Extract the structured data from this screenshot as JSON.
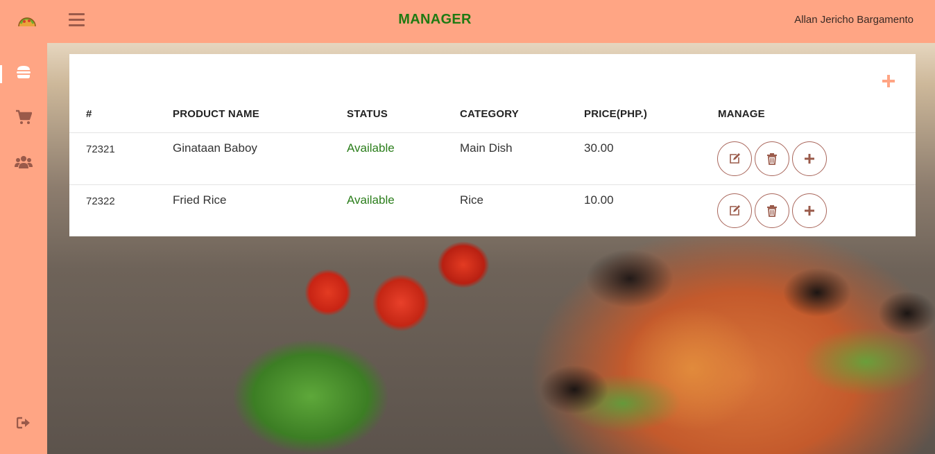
{
  "header": {
    "title": "MANAGER",
    "user_name": "Allan Jericho Bargamento"
  },
  "sidebar": {
    "items": [
      {
        "icon": "burger-icon",
        "active": true
      },
      {
        "icon": "cart-icon",
        "active": false
      },
      {
        "icon": "users-icon",
        "active": false
      }
    ],
    "logout_icon": "sign-out-icon"
  },
  "table": {
    "columns": [
      "#",
      "PRODUCT NAME",
      "STATUS",
      "CATEGORY",
      "PRICE(PHP.)",
      "MANAGE"
    ],
    "rows": [
      {
        "id": "72321",
        "name": "Ginataan Baboy",
        "status": "Available",
        "category": "Main Dish",
        "price": "30.00"
      },
      {
        "id": "72322",
        "name": "Fried Rice",
        "status": "Available",
        "category": "Rice",
        "price": "10.00"
      }
    ],
    "row_actions": [
      "edit-icon",
      "trash-icon",
      "plus-icon"
    ]
  },
  "colors": {
    "accent": "#ffa584",
    "title_green": "#1f7a12",
    "status_green": "#2a7d1a",
    "action_brown": "#a8655a"
  }
}
